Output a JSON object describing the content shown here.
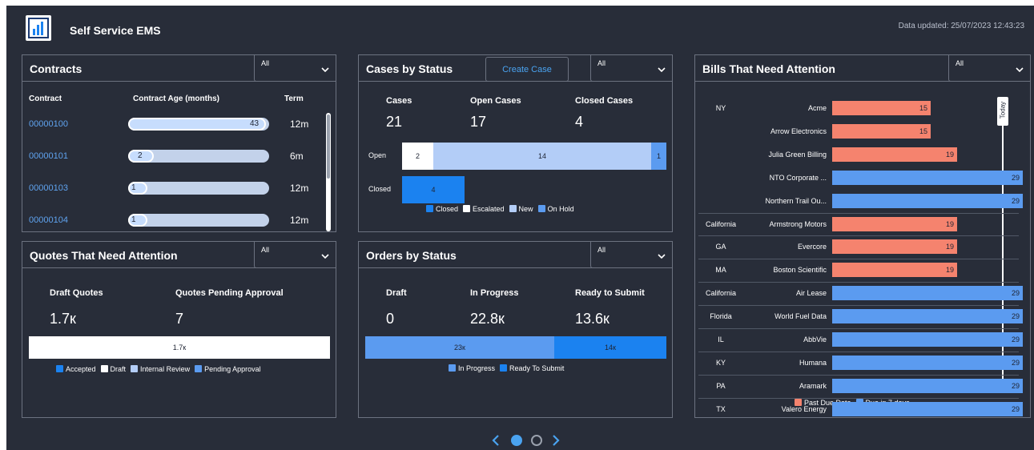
{
  "header": {
    "title": "Self Service EMS",
    "updated": "Data updated: 25/07/2023 12:43:23",
    "logo_icon": "bar-chart-icon"
  },
  "contracts": {
    "title": "Contracts",
    "filter": "All",
    "columns": [
      "Contract",
      "Contract Age (months)",
      "Term"
    ],
    "rows": [
      {
        "id": "00000100",
        "age": "43",
        "age_fraction": 0.98,
        "term": "12m"
      },
      {
        "id": "00000101",
        "age": "2",
        "age_fraction": 0.18,
        "term": "6m"
      },
      {
        "id": "00000103",
        "age": "1",
        "age_fraction": 0.13,
        "term": "12m"
      },
      {
        "id": "00000104",
        "age": "1",
        "age_fraction": 0.13,
        "term": "12m"
      }
    ]
  },
  "cases": {
    "title": "Cases by Status",
    "create_label": "Create Case",
    "filter": "All",
    "kpis": [
      {
        "label": "Cases",
        "value": "21"
      },
      {
        "label": "Open Cases",
        "value": "17"
      },
      {
        "label": "Closed Cases",
        "value": "4"
      }
    ],
    "rows": [
      {
        "label": "Open",
        "segments": [
          {
            "status": "Escalated",
            "value": 2
          },
          {
            "status": "New",
            "value": 14
          },
          {
            "status": "On Hold",
            "value": 1
          }
        ]
      },
      {
        "label": "Closed",
        "segments": [
          {
            "status": "Closed",
            "value": 4
          }
        ]
      }
    ],
    "legend": [
      "Closed",
      "Escalated",
      "New",
      "On Hold"
    ],
    "colors": {
      "Closed": "#1b82f0",
      "Escalated": "#ffffff",
      "New": "#b3cdf7",
      "On Hold": "#5b9bf0"
    }
  },
  "quotes": {
    "title": "Quotes That Need Attention",
    "filter": "All",
    "kpis": [
      {
        "label": "Draft Quotes",
        "value": "1.7к"
      },
      {
        "label": "Quotes Pending Approval",
        "value": "7"
      }
    ],
    "bar_label": "1.7к",
    "legend": [
      "Accepted",
      "Draft",
      "Internal Review",
      "Pending Approval"
    ],
    "colors": {
      "Accepted": "#1b82f0",
      "Draft": "#ffffff",
      "Internal Review": "#b3cdf7",
      "Pending Approval": "#5b9bf0"
    }
  },
  "orders": {
    "title": "Orders by Status",
    "filter": "All",
    "kpis": [
      {
        "label": "Draft",
        "value": "0"
      },
      {
        "label": "In Progress",
        "value": "22.8к"
      },
      {
        "label": "Ready to Submit",
        "value": "13.6к"
      }
    ],
    "segments": [
      {
        "status": "In Progress",
        "label": "23к",
        "value": 22.8
      },
      {
        "status": "Ready To Submit",
        "label": "14к",
        "value": 13.6
      }
    ],
    "legend": [
      "In Progress",
      "Ready To Submit"
    ],
    "colors": {
      "In Progress": "#5b9bf0",
      "Ready To Submit": "#1b82f0"
    }
  },
  "bills": {
    "title": "Bills That Need Attention",
    "filter": "All",
    "today_label": "Today",
    "max_value": 29,
    "rows": [
      {
        "state": "NY",
        "name": "Acme",
        "value": 15,
        "status": "Past Due Date"
      },
      {
        "state": "",
        "name": "Arrow Electronics",
        "value": 15,
        "status": "Past Due Date"
      },
      {
        "state": "",
        "name": "Julia Green Billing",
        "value": 19,
        "status": "Past Due Date"
      },
      {
        "state": "",
        "name": "NTO Corporate ...",
        "value": 29,
        "status": "Due in 7 days"
      },
      {
        "state": "",
        "name": "Northern Trail Ou...",
        "value": 29,
        "status": "Due in 7 days"
      },
      {
        "state": "California",
        "name": "Armstrong Motors",
        "value": 19,
        "status": "Past Due Date"
      },
      {
        "state": "GA",
        "name": "Evercore",
        "value": 19,
        "status": "Past Due Date"
      },
      {
        "state": "MA",
        "name": "Boston Scientific",
        "value": 19,
        "status": "Past Due Date"
      },
      {
        "state": "California",
        "name": "Air Lease",
        "value": 29,
        "status": "Due in 7 days"
      },
      {
        "state": "Florida",
        "name": "World Fuel Data",
        "value": 29,
        "status": "Due in 7 days"
      },
      {
        "state": "IL",
        "name": "AbbVie",
        "value": 29,
        "status": "Due in 7 days"
      },
      {
        "state": "KY",
        "name": "Humana",
        "value": 29,
        "status": "Due in 7 days"
      },
      {
        "state": "PA",
        "name": "Aramark",
        "value": 29,
        "status": "Due in 7 days"
      },
      {
        "state": "TX",
        "name": "Valero Energy",
        "value": 29,
        "status": "Due in 7 days"
      }
    ],
    "legend": [
      "Past Due Date",
      "Due in 7 days"
    ],
    "colors": {
      "Past Due Date": "#f5836e",
      "Due in 7 days": "#5b9bf0"
    }
  },
  "pager": {
    "pages": 2,
    "current": 1
  }
}
